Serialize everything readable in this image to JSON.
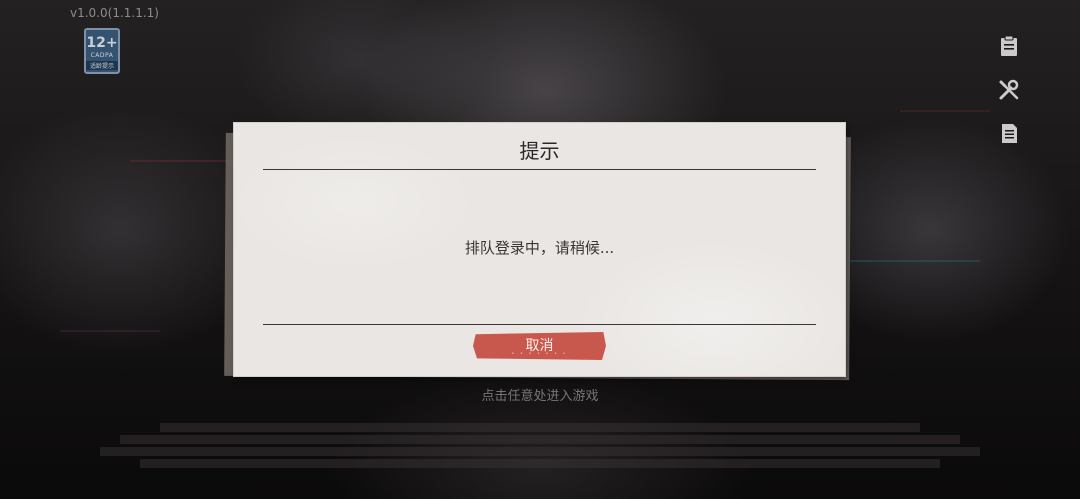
{
  "version": "v1.0.0(1.1.1.1)",
  "age_badge": {
    "rating": "12+",
    "org": "CADPA",
    "tip": "适龄提示"
  },
  "side_icons": [
    "clipboard-icon",
    "wrench-screwdriver-icon",
    "document-list-icon"
  ],
  "enter_hint": "点击任意处进入游戏",
  "dialog": {
    "title": "提示",
    "message": "排队登录中，请稍候...",
    "cancel_label": "取消"
  },
  "colors": {
    "accent_red": "#c8584d",
    "dialog_paper": "#e9e6e3",
    "badge_blue": "#3a5c80"
  }
}
